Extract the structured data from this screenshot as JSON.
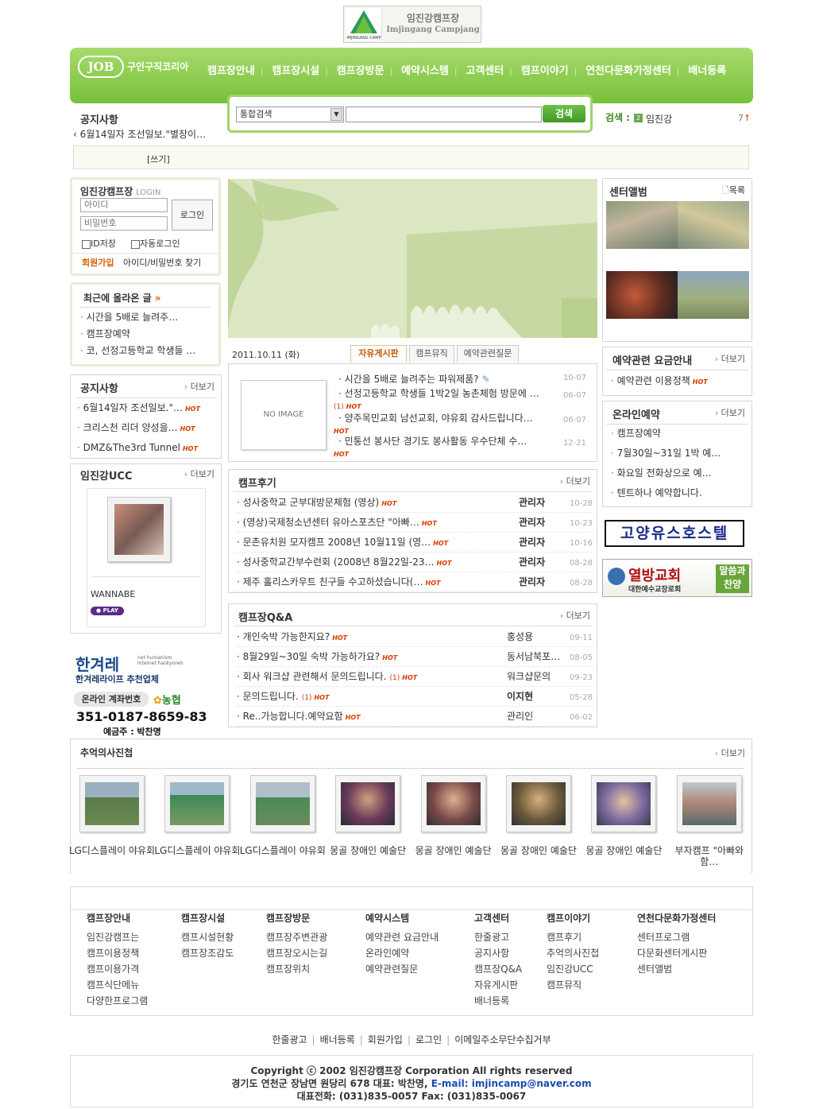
{
  "logo": {
    "name": "임진강캠프장",
    "name_en": "Imjingang Campjang",
    "badge": "IMJINGANG CAMP"
  },
  "jobkorea": {
    "mark": "JOB",
    "text": "구인구직코리아"
  },
  "nav": [
    "캠프장안내",
    "캠프장시설",
    "캠프장방문",
    "예약시스템",
    "고객센터",
    "캠프이야기",
    "연천다문화가정센터",
    "배너등록"
  ],
  "notice_top": {
    "title": "공지사항",
    "item": "6월14일자 조선일보.\"별장이…"
  },
  "search": {
    "select": "통합검색",
    "button": "검색",
    "placeholder": ""
  },
  "keyword": {
    "label": "검색 :",
    "badge": "2",
    "value": "임진강",
    "count": "7"
  },
  "write_link": "[쓰기]",
  "login": {
    "title": "임진강캠프장",
    "subtitle": "LOGIN",
    "id_ph": "아이디",
    "pw_ph": "비밀번호",
    "button": "로그인",
    "save_id": "ID저장",
    "auto": "자동로그인",
    "join": "회원가입",
    "find": "아이디/비밀번호 찾기"
  },
  "recent": {
    "title": "최근에 올라온 글",
    "items": [
      "시간을 5배로 늘려주…",
      "캠프장예약",
      "코, 선정고등학교 학생들 …"
    ]
  },
  "notice": {
    "title": "공지사항",
    "more": "더보기",
    "items": [
      "6월14일자 조선일보.\"…",
      "크리스천 리더 양성을…",
      "DMZ&The3rd Tunnel"
    ]
  },
  "ucc": {
    "title": "임진강UCC",
    "more": "더보기",
    "name": "WANNABE",
    "play": "PLAY"
  },
  "hani": {
    "logo": "한겨레",
    "tag1": "net humanism",
    "tag2": "internet hankyoreh",
    "sub": "한겨레라이프 추천업체",
    "acct_label": "온라인 계좌번호",
    "bank": "농협",
    "acct": "351-0187-8659-83",
    "holder": "예금주 : 박찬명"
  },
  "date": "2011.10.11 (화)",
  "tabs": [
    "자유게시판",
    "캠프뮤직",
    "예약관련질문"
  ],
  "noimage": "NO IMAGE",
  "board": [
    {
      "t": "시간을 5배로 늘려주는 파워제품?",
      "d": "10-07"
    },
    {
      "t": "선정고등학교 학생들 1박2일 농촌체험 방문에 …",
      "c": "(1)",
      "d": "06-07"
    },
    {
      "t": "양주목민교회 남선교회, 야유회 감사드립니다…",
      "d": "06-07"
    },
    {
      "t": "민통선 봉사단 경기도 봉사활동 우수단체 수…",
      "d": "12-21"
    }
  ],
  "review": {
    "title": "캠프후기",
    "more": "더보기",
    "items": [
      {
        "t": "성사중학교 군부대방문체험 (영상)",
        "a": "관리자",
        "d": "10-28"
      },
      {
        "t": "(영상)국제청소년센터 유아스포츠단 \"아빠…",
        "a": "관리자",
        "d": "10-23"
      },
      {
        "t": "문촌유치원 모자캠프 2008년 10월11일 (영…",
        "a": "관리자",
        "d": "10-16"
      },
      {
        "t": "성사중학교간부수련회 (2008년 8월22일-23…",
        "a": "관리자",
        "d": "08-28"
      },
      {
        "t": "제주 홀리스카우트 친구들 수고하셨습니다(…",
        "a": "관리자",
        "d": "08-28"
      }
    ]
  },
  "qa": {
    "title": "캠프장Q&A",
    "more": "더보기",
    "items": [
      {
        "t": "개인숙박 가능한지요?",
        "a": "홍성용",
        "d": "09-11"
      },
      {
        "t": "8월29일~30일 숙박 가능하가요?",
        "a": "동서남북포…",
        "d": "08-05"
      },
      {
        "t": "회사 워크샵 관련해서 문의드립니다.",
        "c": "(1)",
        "a": "워크샵문의",
        "d": "09-23"
      },
      {
        "t": "문의드립니다.",
        "c": "(1)",
        "a": "이지현",
        "d": "05-28"
      },
      {
        "t": "Re..가능합니다.예약요함",
        "a": "관리인",
        "d": "06-02"
      }
    ]
  },
  "album": {
    "title": "센터앨범",
    "more": "목록"
  },
  "fee": {
    "title": "예약관련 요금안내",
    "more": "더보기",
    "items": [
      "예약관련 이용정책"
    ]
  },
  "online": {
    "title": "온라인예약",
    "more": "더보기",
    "items": [
      "캠프장예약",
      "7월30일~31일 1박 예…",
      "화요일 전화상으로 예…",
      "텐트하나 예약합니다."
    ]
  },
  "goyang": "고양유스호스텔",
  "church": {
    "name": "열방교회",
    "sub": "대한예수교장로회",
    "side": "말씀과 찬양"
  },
  "memory": {
    "title": "추억의사진첩",
    "more": "더보기",
    "caps": [
      "LG디스플레이 야유회",
      "LG디스플레이 야유회",
      "LG디스플레이 야유회",
      "몽골 장애인 예술단",
      "몽골 장애인 예술단",
      "몽골 장애인 예술단",
      "몽골 장애인 예술단",
      "부자캠프 \"아빠와 함…"
    ]
  },
  "footer_cols": [
    {
      "t": "캠프장안내",
      "i": [
        "임진강캠프는",
        "캠프이용정책",
        "캠프이용가격",
        "캠프식단메뉴",
        "다양한프로그램"
      ]
    },
    {
      "t": "캠프장시설",
      "i": [
        "캠프시설현황",
        "캠프장조감도"
      ]
    },
    {
      "t": "캠프장방문",
      "i": [
        "캠프장주변관광",
        "캠프장오시는길",
        "캠프장위치"
      ]
    },
    {
      "t": "예약시스템",
      "i": [
        "예약관련 요금안내",
        "온라인예약",
        "예약관련질문"
      ]
    },
    {
      "t": "고객센터",
      "i": [
        "한줄광고",
        "공지사항",
        "캠프장Q&A",
        "자유게시판",
        "배너등록"
      ]
    },
    {
      "t": "캠프이야기",
      "i": [
        "캠프후기",
        "추억의사진첩",
        "임진강UCC",
        "캠프뮤직"
      ]
    },
    {
      "t": "연천다문화가정센터",
      "i": [
        "센터프로그램",
        "다문화센터게시판",
        "센터앨범"
      ]
    }
  ],
  "bottom_links": [
    "한줄광고",
    "배너등록",
    "회원가입",
    "로그인",
    "이메일주소무단수집거부"
  ],
  "copyright": "Copyright ⓒ 2002 임진강캠프장 Corporation All rights reserved",
  "address": "경기도 연천군 장남면 원당리 678 대표: 박찬명,",
  "email": "E-mail: imjincamp@naver.com",
  "phone": "대표전화: (031)835-0057  Fax: (031)835-0067",
  "colors": {
    "green": "#7cc43c",
    "hot": "#d63b00",
    "orange": "#c35a00"
  }
}
